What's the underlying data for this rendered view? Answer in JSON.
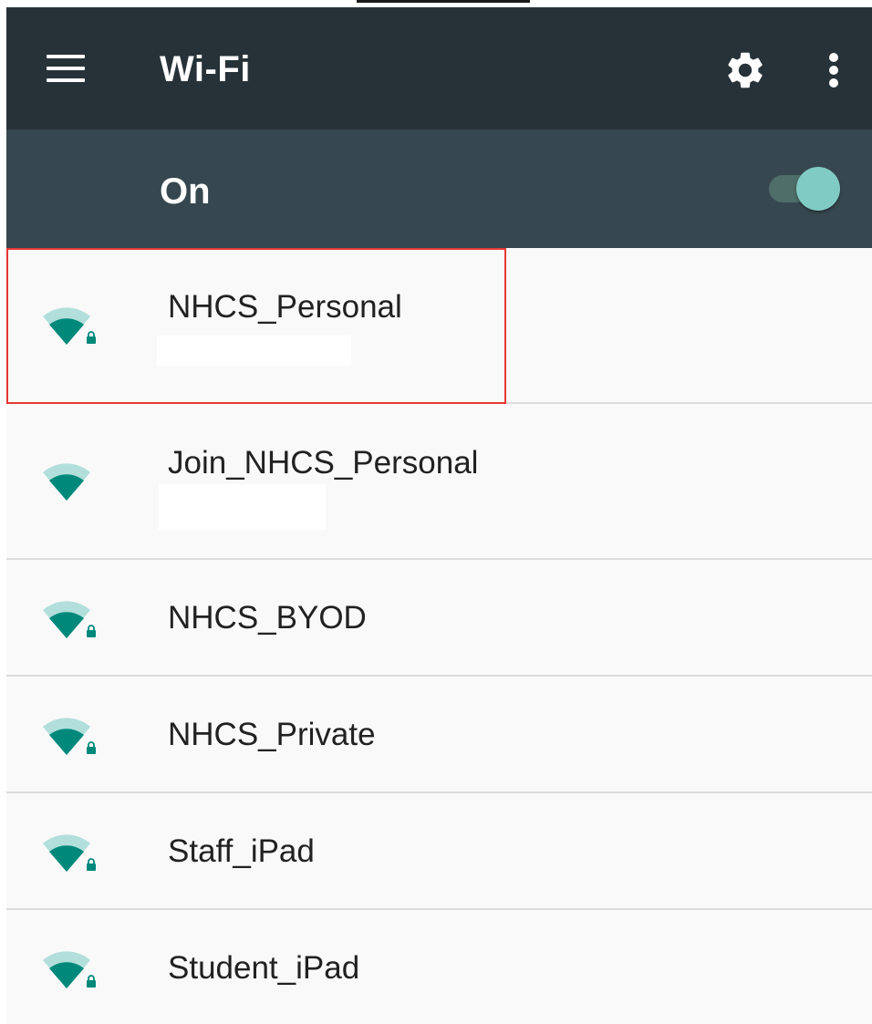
{
  "app_bar": {
    "title": "Wi-Fi",
    "icons": [
      "menu-icon",
      "gear-icon",
      "more-vert-icon"
    ]
  },
  "switch_bar": {
    "label": "On",
    "toggle_on": true
  },
  "networks": [
    {
      "name": "NHCS_Personal",
      "status": "",
      "secured": true
    },
    {
      "name": "Join_NHCS_Personal",
      "status": "",
      "secured": false
    },
    {
      "name": "NHCS_BYOD",
      "secured": true
    },
    {
      "name": "NHCS_Private",
      "secured": true
    },
    {
      "name": "Staff_iPad",
      "secured": true
    },
    {
      "name": "Student_iPad",
      "secured": true
    }
  ],
  "colors": {
    "app_bar": "#263238",
    "switch_bar": "#37474f",
    "accent": "#80cbc4",
    "wifi_signal": "#00897b",
    "highlight": "#e53935"
  }
}
